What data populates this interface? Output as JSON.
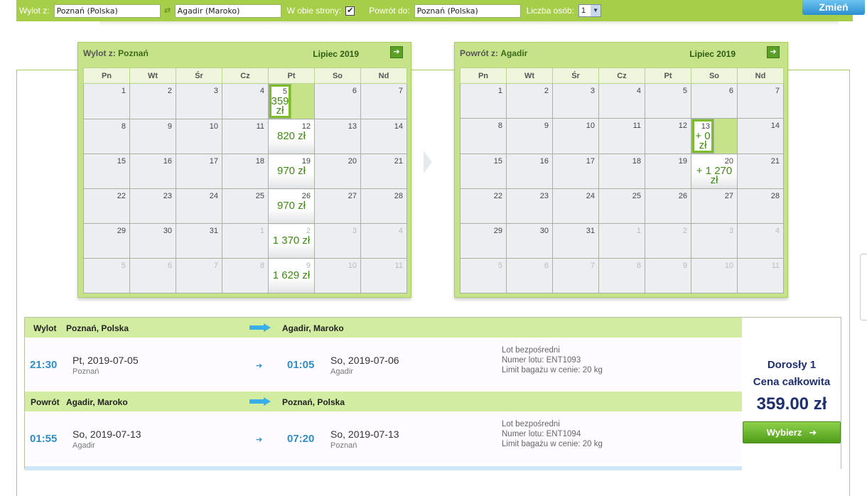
{
  "search": {
    "from_label": "Wylot z:",
    "from_value": "Poznań (Polska)",
    "to_value": "Agadir (Maroko)",
    "both_ways_label": "W obie strony:",
    "both_ways_checked": "✔",
    "return_label": "Powrót do:",
    "return_value": "Poznań (Polska)",
    "persons_label": "Liczba osób:",
    "persons_value": "1",
    "change_button": "Zmień"
  },
  "calendars": [
    {
      "title_prefix": "Wylot z:",
      "title_city": "Poznań",
      "month": "Lipiec 2019",
      "days_header": [
        "Pn",
        "Wt",
        "Śr",
        "Cz",
        "Pt",
        "So",
        "Nd"
      ],
      "weeks": [
        [
          {
            "d": "1"
          },
          {
            "d": "2"
          },
          {
            "d": "3"
          },
          {
            "d": "4"
          },
          {
            "d": "5",
            "p": "359 zł",
            "sel": true
          },
          {
            "d": "6"
          },
          {
            "d": "7"
          }
        ],
        [
          {
            "d": "8"
          },
          {
            "d": "9"
          },
          {
            "d": "10"
          },
          {
            "d": "11"
          },
          {
            "d": "12",
            "p": "820 zł"
          },
          {
            "d": "13"
          },
          {
            "d": "14"
          }
        ],
        [
          {
            "d": "15"
          },
          {
            "d": "16"
          },
          {
            "d": "17"
          },
          {
            "d": "18"
          },
          {
            "d": "19",
            "p": "970 zł"
          },
          {
            "d": "20"
          },
          {
            "d": "21"
          }
        ],
        [
          {
            "d": "22"
          },
          {
            "d": "23"
          },
          {
            "d": "24"
          },
          {
            "d": "25"
          },
          {
            "d": "26",
            "p": "970 zł"
          },
          {
            "d": "27"
          },
          {
            "d": "28"
          }
        ],
        [
          {
            "d": "29"
          },
          {
            "d": "30"
          },
          {
            "d": "31"
          },
          {
            "d": "1",
            "out": true
          },
          {
            "d": "2",
            "out": true,
            "p": "1 370 zł"
          },
          {
            "d": "3",
            "out": true
          },
          {
            "d": "4",
            "out": true
          }
        ],
        [
          {
            "d": "5",
            "out": true
          },
          {
            "d": "6",
            "out": true
          },
          {
            "d": "7",
            "out": true
          },
          {
            "d": "8",
            "out": true
          },
          {
            "d": "9",
            "out": true,
            "p": "1 629 zł"
          },
          {
            "d": "10",
            "out": true
          },
          {
            "d": "11",
            "out": true
          }
        ]
      ]
    },
    {
      "title_prefix": "Powrót z:",
      "title_city": "Agadir",
      "month": "Lipiec 2019",
      "days_header": [
        "Pn",
        "Wt",
        "Śr",
        "Cz",
        "Pt",
        "So",
        "Nd"
      ],
      "weeks": [
        [
          {
            "d": "1"
          },
          {
            "d": "2"
          },
          {
            "d": "3"
          },
          {
            "d": "4"
          },
          {
            "d": "5"
          },
          {
            "d": "6"
          },
          {
            "d": "7"
          }
        ],
        [
          {
            "d": "8"
          },
          {
            "d": "9"
          },
          {
            "d": "10"
          },
          {
            "d": "11"
          },
          {
            "d": "12"
          },
          {
            "d": "13",
            "p": "+ 0 zł",
            "sel": true
          },
          {
            "d": "14"
          }
        ],
        [
          {
            "d": "15"
          },
          {
            "d": "16"
          },
          {
            "d": "17"
          },
          {
            "d": "18"
          },
          {
            "d": "19"
          },
          {
            "d": "20",
            "p": "+ 1 270 zł"
          },
          {
            "d": "21"
          }
        ],
        [
          {
            "d": "22"
          },
          {
            "d": "23"
          },
          {
            "d": "24"
          },
          {
            "d": "25"
          },
          {
            "d": "26"
          },
          {
            "d": "27"
          },
          {
            "d": "28"
          }
        ],
        [
          {
            "d": "29"
          },
          {
            "d": "30"
          },
          {
            "d": "31"
          },
          {
            "d": "1",
            "out": true
          },
          {
            "d": "2",
            "out": true
          },
          {
            "d": "3",
            "out": true
          },
          {
            "d": "4",
            "out": true
          }
        ],
        [
          {
            "d": "5",
            "out": true
          },
          {
            "d": "6",
            "out": true
          },
          {
            "d": "7",
            "out": true
          },
          {
            "d": "8",
            "out": true
          },
          {
            "d": "9",
            "out": true
          },
          {
            "d": "10",
            "out": true
          },
          {
            "d": "11",
            "out": true
          }
        ]
      ]
    }
  ],
  "outbound": {
    "tag": "Wylot",
    "from": "Poznań, Polska",
    "to": "Agadir, Maroko",
    "dep_time": "21:30",
    "dep_date": "Pt, 2019-07-05",
    "dep_place": "Poznań",
    "arr_time": "01:05",
    "arr_date": "So, 2019-07-06",
    "arr_place": "Agadir",
    "info1": "Lot bezpośredni",
    "info2": "Numer lotu: ENT1093",
    "info3": "Limit bagażu w cenie: 20 kg"
  },
  "inbound": {
    "tag": "Powrót",
    "from": "Agadir, Maroko",
    "to": "Poznań, Polska",
    "dep_time": "01:55",
    "dep_date": "So, 2019-07-13",
    "dep_place": "Agadir",
    "arr_time": "07:20",
    "arr_date": "So, 2019-07-13",
    "arr_place": "Poznań",
    "info1": "Lot bezpośredni",
    "info2": "Numer lotu: ENT1094",
    "info3": "Limit bagażu w cenie: 20 kg"
  },
  "price": {
    "passenger": "Dorosły 1",
    "total_label": "Cena całkowita",
    "total": "359.00 zł",
    "select_button": "Wybierz"
  },
  "colors": {
    "green_bar": "#a7ce48",
    "accent_blue": "#2c8ecb",
    "price_green": "#3e8a12",
    "navy": "#1f2f70"
  }
}
